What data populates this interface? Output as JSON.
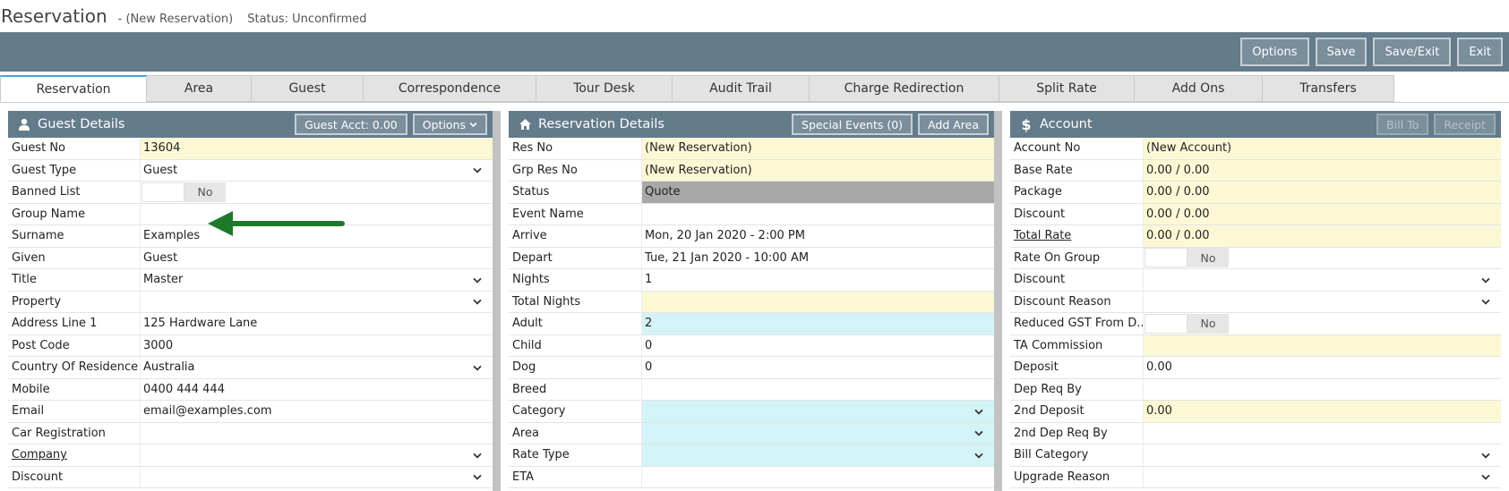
{
  "header": {
    "title": "Reservation",
    "subtitle": "- (New Reservation)",
    "status": "Status: Unconfirmed"
  },
  "toolbar": {
    "buttons": [
      "Options",
      "Save",
      "Save/Exit",
      "Exit"
    ]
  },
  "tabs": [
    "Reservation",
    "Area",
    "Guest",
    "Correspondence",
    "Tour Desk",
    "Audit Trail",
    "Charge Redirection",
    "Split Rate",
    "Add Ons",
    "Transfers"
  ],
  "guest": {
    "title": "Guest Details",
    "icon": "person-icon",
    "acct_button": "Guest Acct: 0.00",
    "options_button": "Options",
    "rows": [
      {
        "label": "Guest No",
        "value": "13604",
        "bg": "yellow"
      },
      {
        "label": "Guest Type",
        "value": "Guest",
        "dropdown": true
      },
      {
        "label": "Banned List",
        "toggle": "No"
      },
      {
        "label": "Group Name",
        "value": ""
      },
      {
        "label": "Surname",
        "value": "Examples"
      },
      {
        "label": "Given",
        "value": "Guest"
      },
      {
        "label": "Title",
        "value": "Master",
        "dropdown": true
      },
      {
        "label": "Property",
        "value": "",
        "dropdown": true
      },
      {
        "label": "Address Line 1",
        "value": "125 Hardware Lane"
      },
      {
        "label": "Post Code",
        "value": "3000"
      },
      {
        "label": "Country Of Residence",
        "value": "Australia",
        "dropdown": true
      },
      {
        "label": "Mobile",
        "value": "0400 444 444"
      },
      {
        "label": "Email",
        "value": "email@examples.com"
      },
      {
        "label": "Car Registration",
        "value": ""
      },
      {
        "label": "Company",
        "value": "",
        "dropdown": true,
        "underline": true
      },
      {
        "label": "Discount",
        "value": "",
        "dropdown": true
      }
    ]
  },
  "reservation": {
    "title": "Reservation Details",
    "icon": "home-icon",
    "events_button": "Special Events (0)",
    "area_button": "Add Area",
    "rows": [
      {
        "label": "Res No",
        "value": "(New Reservation)",
        "bg": "yellow"
      },
      {
        "label": "Grp Res No",
        "value": "(New Reservation)",
        "bg": "yellow"
      },
      {
        "label": "Status",
        "value": "Quote",
        "bg": "grey"
      },
      {
        "label": "Event Name",
        "value": ""
      },
      {
        "label": "Arrive",
        "value": "Mon, 20 Jan 2020 - 2:00 PM"
      },
      {
        "label": "Depart",
        "value": "Tue, 21 Jan 2020 - 10:00 AM"
      },
      {
        "label": "Nights",
        "value": "1"
      },
      {
        "label": "Total Nights",
        "value": "",
        "bg": "yellow"
      },
      {
        "label": "Adult",
        "value": "2",
        "bg": "cyan"
      },
      {
        "label": "Child",
        "value": "0"
      },
      {
        "label": "Dog",
        "value": "0"
      },
      {
        "label": "Breed",
        "value": ""
      },
      {
        "label": "Category",
        "value": "",
        "bg": "cyan",
        "dropdown": true
      },
      {
        "label": "Area",
        "value": "",
        "bg": "cyan",
        "dropdown": true
      },
      {
        "label": "Rate Type",
        "value": "",
        "bg": "cyan",
        "dropdown": true
      },
      {
        "label": "ETA",
        "value": ""
      }
    ]
  },
  "account": {
    "title": "Account",
    "icon": "dollar-icon",
    "billto_button": "Bill To",
    "receipt_button": "Receipt",
    "rows": [
      {
        "label": "Account No",
        "value": "(New Account)",
        "bg": "yellow"
      },
      {
        "label": "Base Rate",
        "value": "0.00 / 0.00",
        "bg": "yellow"
      },
      {
        "label": "Package",
        "value": "0.00 / 0.00",
        "bg": "yellow"
      },
      {
        "label": "Discount",
        "value": "0.00 / 0.00",
        "bg": "yellow"
      },
      {
        "label": "Total Rate",
        "value": "0.00 / 0.00",
        "bg": "yellow",
        "underline": true
      },
      {
        "label": "Rate On Group",
        "toggle": "No"
      },
      {
        "label": "Discount",
        "value": "",
        "dropdown": true
      },
      {
        "label": "Discount Reason",
        "value": "",
        "dropdown": true
      },
      {
        "label": "Reduced GST From D...",
        "toggle": "No"
      },
      {
        "label": "TA Commission",
        "value": "",
        "bg": "yellow"
      },
      {
        "label": "Deposit",
        "value": "0.00"
      },
      {
        "label": "Dep Req By",
        "value": ""
      },
      {
        "label": "2nd Deposit",
        "value": "0.00",
        "bg": "yellow"
      },
      {
        "label": "2nd Dep Req By",
        "value": ""
      },
      {
        "label": "Bill Category",
        "value": "",
        "dropdown": true
      },
      {
        "label": "Upgrade Reason",
        "value": "",
        "dropdown": true
      }
    ]
  },
  "colors": {
    "header_bg": "#637b8a",
    "yellow_field": "#fcf8d5",
    "cyan_field": "#d4f3f6",
    "arrow": "#1e7a2a"
  }
}
